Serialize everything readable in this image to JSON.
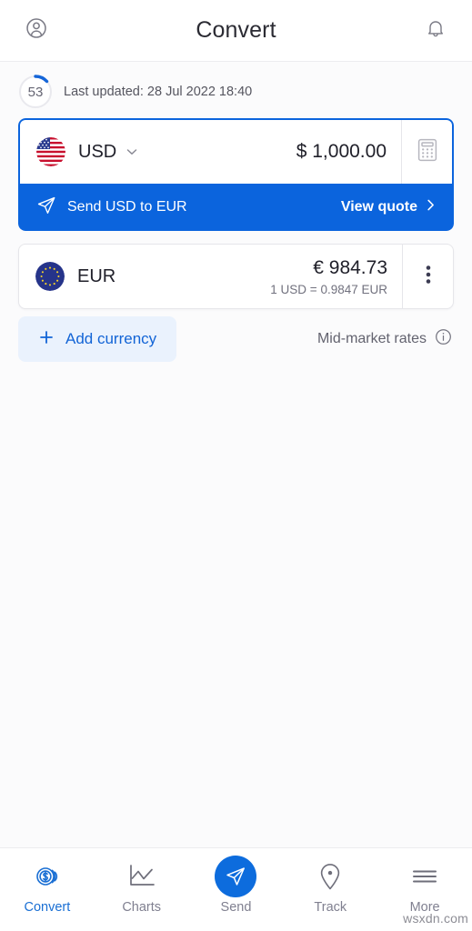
{
  "header": {
    "title": "Convert",
    "profile_icon": "account-circle-icon",
    "bell_icon": "bell-icon"
  },
  "status": {
    "countdown_value": "53",
    "last_updated": "Last updated: 28 Jul 2022 18:40"
  },
  "source_currency": {
    "flag": "us-flag-icon",
    "code": "USD",
    "amount": "$ 1,000.00",
    "action_icon": "calculator-icon",
    "chevron_icon": "chevron-down-icon"
  },
  "send_banner": {
    "icon": "send-plane-icon",
    "label": "Send USD to EUR",
    "quote_label": "View quote",
    "chevron_icon": "chevron-right-icon"
  },
  "target_currency": {
    "flag": "eu-flag-icon",
    "code": "EUR",
    "amount": "€ 984.73",
    "rate": "1 USD = 0.9847 EUR",
    "action_icon": "more-vertical-icon"
  },
  "actions": {
    "add_currency_label": "Add currency",
    "plus_icon": "plus-icon",
    "midmarket_label": "Mid-market rates",
    "info_icon": "info-circle-icon"
  },
  "bottom_nav": {
    "items": [
      {
        "label": "Convert",
        "icon": "coin-dollar-icon",
        "active": true
      },
      {
        "label": "Charts",
        "icon": "line-chart-icon",
        "active": false
      },
      {
        "label": "Send",
        "icon": "send-plane-icon",
        "active": false
      },
      {
        "label": "Track",
        "icon": "location-pin-icon",
        "active": false
      },
      {
        "label": "More",
        "icon": "hamburger-menu-icon",
        "active": false
      }
    ]
  },
  "watermark": "wsxdn.com",
  "colors": {
    "brand_blue": "#0b64dd",
    "accent_light_blue": "#eaf2fd",
    "text_dark": "#20202a",
    "text_muted": "#71717e"
  }
}
